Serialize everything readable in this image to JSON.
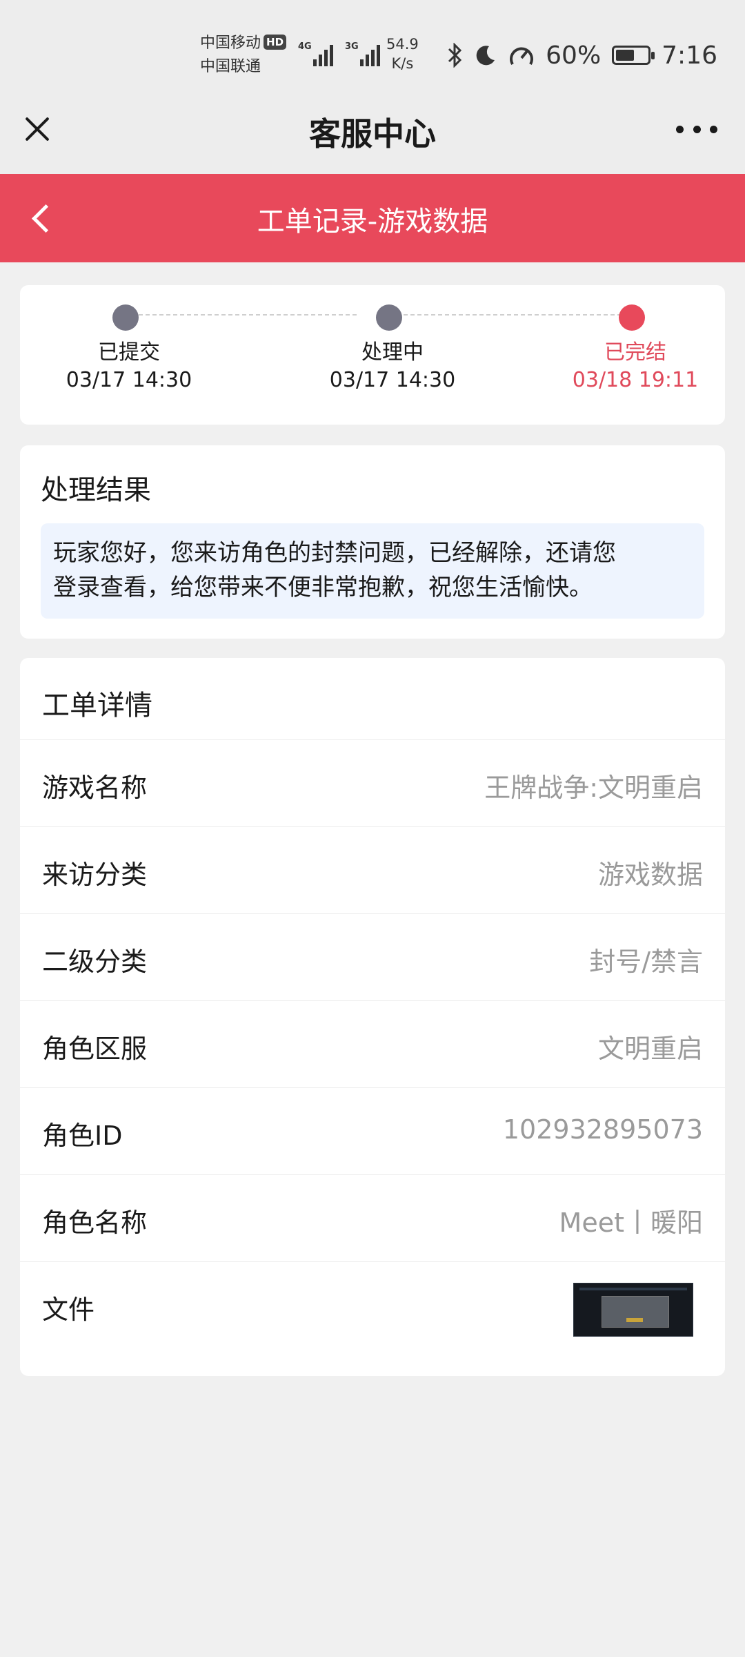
{
  "status_bar": {
    "carrier1": "中国移动",
    "carrier1_badge": "HD",
    "carrier2": "中国联通",
    "net1": "4G",
    "net2": "3G",
    "speed_value": "54.9",
    "speed_unit": "K/s",
    "battery_percent": "60%",
    "battery_level": 0.6,
    "time": "7:16",
    "icons": [
      "bluetooth-icon",
      "moon-icon",
      "gauge-icon",
      "battery-icon"
    ]
  },
  "title_bar": {
    "title": "客服中心",
    "close_icon": "close-icon",
    "more_icon": "more-dots-icon"
  },
  "header": {
    "title": "工单记录-游戏数据",
    "back_icon": "chevron-left-icon",
    "color": "#e8495b"
  },
  "progress": {
    "steps": [
      {
        "label": "已提交",
        "time": "03/17 14:30",
        "state": "done-gray"
      },
      {
        "label": "处理中",
        "time": "03/17 14:30",
        "state": "done-gray"
      },
      {
        "label": "已完结",
        "time": "03/18 19:11",
        "state": "current"
      }
    ],
    "active_color": "#e8495b",
    "inactive_color": "#757584"
  },
  "result": {
    "title": "处理结果",
    "line1": "玩家您好，您来访角色的封禁问题，已经解除，还请您",
    "line2": "登录查看，给您带来不便非常抱歉，祝您生活愉快。"
  },
  "details": {
    "title": "工单详情",
    "rows": [
      {
        "key": "游戏名称",
        "value": "王牌战争:文明重启"
      },
      {
        "key": "来访分类",
        "value": "游戏数据"
      },
      {
        "key": "二级分类",
        "value": "封号/禁言"
      },
      {
        "key": "角色区服",
        "value": "文明重启"
      },
      {
        "key": "角色ID",
        "value": "102932895073"
      },
      {
        "key": "角色名称",
        "value": "Meet丨暖阳"
      }
    ],
    "file_label": "文件"
  }
}
